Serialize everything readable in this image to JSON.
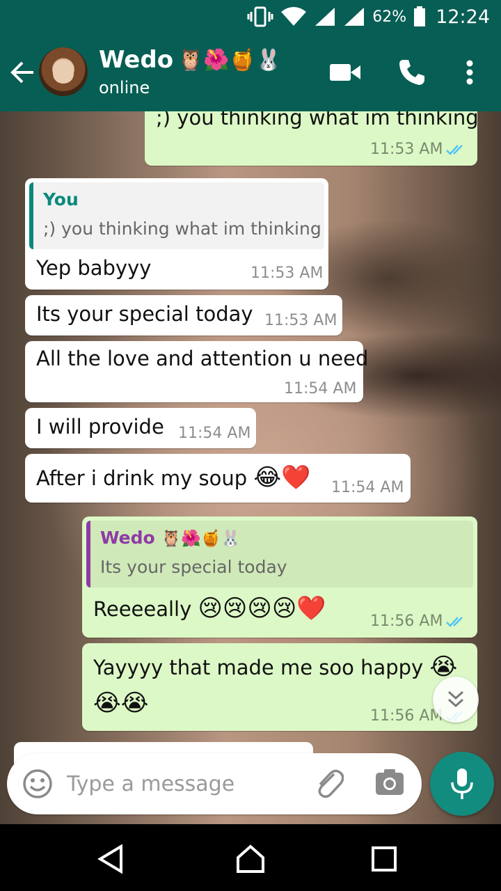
{
  "status_bar": {
    "battery": "62%",
    "time": "12:24"
  },
  "header": {
    "name": "Wedo",
    "name_emojis": "🦉🌺🍯🐰",
    "status": "online"
  },
  "messages": [
    {
      "dir": "out",
      "text": ";) you thinking what im thinking",
      "time": "11:53 AM",
      "read": true
    },
    {
      "dir": "in",
      "quote_author": "You",
      "quote_text": ";) you thinking what im thinking",
      "text": "Yep babyyy",
      "time": "11:53 AM"
    },
    {
      "dir": "in",
      "text": "Its your special today",
      "time": "11:53 AM"
    },
    {
      "dir": "in",
      "text": "All the love and attention u need",
      "time": "11:54 AM"
    },
    {
      "dir": "in",
      "text": "I will provide",
      "time": "11:54 AM"
    },
    {
      "dir": "in",
      "text": "After i drink my soup",
      "emojis": "😂❤️",
      "time": "11:54 AM"
    },
    {
      "dir": "out",
      "quote_author": "Wedo",
      "quote_author_emojis": "🦉🌺🍯🐰",
      "quote_text": "Its your special today",
      "text": "Reeeeally",
      "emojis": "😢😢😢😢❤️",
      "time": "11:56 AM",
      "read": true
    },
    {
      "dir": "out",
      "text": "Yayyyy that made me soo happy",
      "emojis": "😭",
      "emojis_line2": "😭😭",
      "time": "11:56 AM",
      "read": true
    }
  ],
  "composer": {
    "placeholder": "Type a message"
  },
  "colors": {
    "header": "#075e54",
    "outgoing_bubble": "#dcf8c6",
    "incoming_bubble": "#ffffff",
    "read_ticks": "#4fc3f7",
    "mic_button": "#128c7e"
  },
  "icons": [
    "vibrate-icon",
    "wifi-icon",
    "signal-icon",
    "battery-icon",
    "back-arrow-icon",
    "video-call-icon",
    "phone-icon",
    "more-vert-icon",
    "emoji-icon",
    "attach-icon",
    "camera-icon",
    "mic-icon",
    "scroll-down-icon",
    "nav-back-icon",
    "nav-home-icon",
    "nav-recents-icon"
  ]
}
